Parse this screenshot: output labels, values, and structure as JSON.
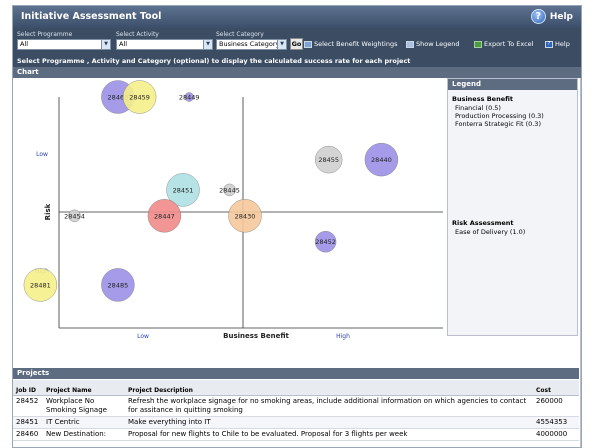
{
  "window": {
    "title": "Initiative Assessment Tool",
    "help_label": "Help"
  },
  "toolbar": {
    "programme": {
      "label": "Select Programme",
      "value": "All"
    },
    "activity": {
      "label": "Select Activity",
      "value": "All"
    },
    "category": {
      "label": "Select Category",
      "value": "Business Category"
    },
    "go_label": "Go",
    "links": {
      "weightings": "Select Benefit Weightings",
      "legend": "Show Legend",
      "excel": "Export To Excel",
      "help": "Help"
    }
  },
  "info_text": "Select Programme , Activity and Category (optional) to display the calculated success rate for each project",
  "chart_section_title": "Chart",
  "chart_data": {
    "type": "scatter",
    "xlabel": "Business Benefit",
    "ylabel": "Risk",
    "x_ticks": [
      "Low",
      "High"
    ],
    "y_ticks": [
      "Low",
      "High"
    ],
    "points": [
      {
        "id": "28463",
        "x": 0.19,
        "y": 1.0,
        "size": 11,
        "color": "#9b90e6"
      },
      {
        "id": "28459",
        "x": 0.26,
        "y": 1.0,
        "size": 11,
        "color": "#f5ef88"
      },
      {
        "id": "28449",
        "x": 0.42,
        "y": 1.0,
        "size": 3,
        "color": "#9b90e6"
      },
      {
        "id": "28455",
        "x": 0.87,
        "y": 0.71,
        "size": 9,
        "color": "#cfcfcf"
      },
      {
        "id": "28440",
        "x": 1.04,
        "y": 0.71,
        "size": 11,
        "color": "#9b90e6"
      },
      {
        "id": "28451",
        "x": 0.4,
        "y": 0.57,
        "size": 11,
        "color": "#aee0e3"
      },
      {
        "id": "28445",
        "x": 0.55,
        "y": 0.57,
        "size": 4,
        "color": "#cfcfcf"
      },
      {
        "id": "28454",
        "x": 0.05,
        "y": 0.45,
        "size": 4,
        "color": "#cfcfcf"
      },
      {
        "id": "28447",
        "x": 0.34,
        "y": 0.45,
        "size": 11,
        "color": "#f08a8a"
      },
      {
        "id": "28430",
        "x": 0.6,
        "y": 0.45,
        "size": 11,
        "color": "#f5c89a"
      },
      {
        "id": "28452",
        "x": 0.86,
        "y": 0.33,
        "size": 7,
        "color": "#9b90e6"
      },
      {
        "id": "28481",
        "x": -0.06,
        "y": 0.13,
        "size": 11,
        "color": "#f5ef88"
      },
      {
        "id": "28485",
        "x": 0.19,
        "y": 0.13,
        "size": 11,
        "color": "#9b90e6"
      }
    ]
  },
  "legend": {
    "title": "Legend",
    "business_benefit": {
      "title": "Business Benefit",
      "items": [
        "Financial (0.5)",
        "Production Processing (0.3)",
        "Fonterra Strategic Fit (0.3)"
      ]
    },
    "risk_assessment": {
      "title": "Risk Assessment",
      "items": [
        "Ease of Delivery (1.0)"
      ]
    }
  },
  "projects": {
    "title": "Projects",
    "columns": [
      "Job ID",
      "Project Name",
      "Project Description",
      "Cost"
    ],
    "rows": [
      {
        "id": "28452",
        "name": "Workplace No Smoking Signage",
        "description": "Refresh the workplace signage for no smoking areas, include additional information on which agencies to contact for assitance in quitting smoking",
        "cost": "260000"
      },
      {
        "id": "28451",
        "name": "IT Centric",
        "description": "Make everything into IT",
        "cost": "4554353"
      },
      {
        "id": "28460",
        "name": "New Destination:",
        "description": "Proposal for new flights to Chile to be evaluated. Proposal for 3 flights per week",
        "cost": "4000000"
      }
    ]
  }
}
